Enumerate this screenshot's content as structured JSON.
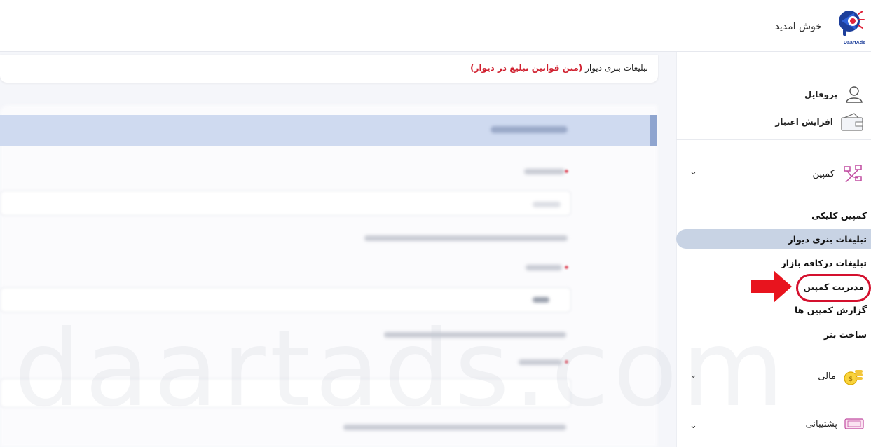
{
  "header": {
    "logo_text": "DaartAds",
    "welcome": "خوش امدید"
  },
  "notice": {
    "text": "تبلیغات بنری دیوار ",
    "link": "(متن قوانین تبلیغ در دیوار)"
  },
  "sidebar": {
    "profile": "پروفایل",
    "add_credit": "افزایش اعتبار",
    "campaign": "کمپین",
    "campaign_sub": [
      "کمپین کلیکی",
      "تبلیغات بنری دیوار",
      "تبلیغات درکافه بازار",
      "مدیریت کمپین",
      "گزارش کمپین ها",
      "ساخت بنر"
    ],
    "finance": "مالی",
    "support": "پشتیبانی"
  },
  "watermark": "daartads.com",
  "colors": {
    "accent": "#d4102e",
    "active_bg": "#c8d3e4",
    "card_head": "#cfdaf0"
  }
}
